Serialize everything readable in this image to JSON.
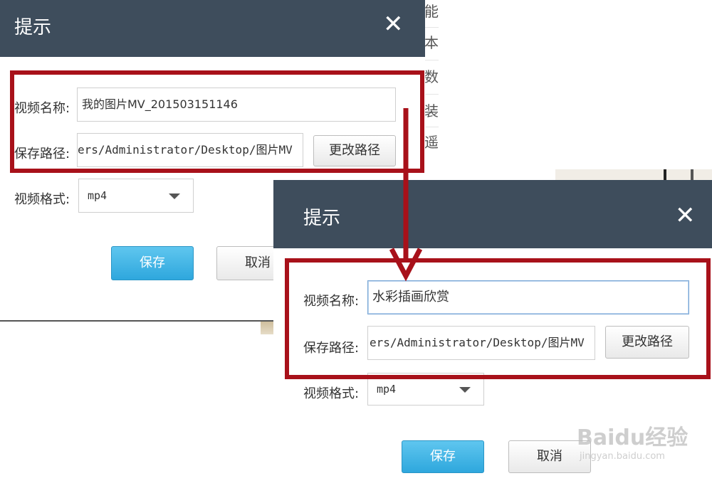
{
  "background": {
    "page_text": [
      "能",
      "本",
      "数",
      "装",
      "遥"
    ],
    "accent_color": "#a8111a"
  },
  "dialog_before": {
    "title": "提示",
    "close_symbol": "✕",
    "name_label": "视频名称:",
    "name_value": "我的图片MV_201503151146",
    "path_label": "保存路径:",
    "path_value": "ers/Administrator/Desktop/图片MV",
    "change_path_label": "更改路径",
    "format_label": "视频格式:",
    "format_value": "mp4",
    "save_label": "保存",
    "cancel_label": "取消"
  },
  "dialog_after": {
    "title": "提示",
    "close_symbol": "✕",
    "name_label": "视频名称:",
    "name_value": "水彩插画欣赏",
    "path_label": "保存路径:",
    "path_value": "ers/Administrator/Desktop/图片MV",
    "change_path_label": "更改路径",
    "format_label": "视频格式:",
    "format_value": "mp4",
    "save_label": "保存",
    "cancel_label": "取消"
  },
  "watermark": {
    "logo_text": "Baidu经验",
    "url_text": "jingyan.baidu.com"
  }
}
